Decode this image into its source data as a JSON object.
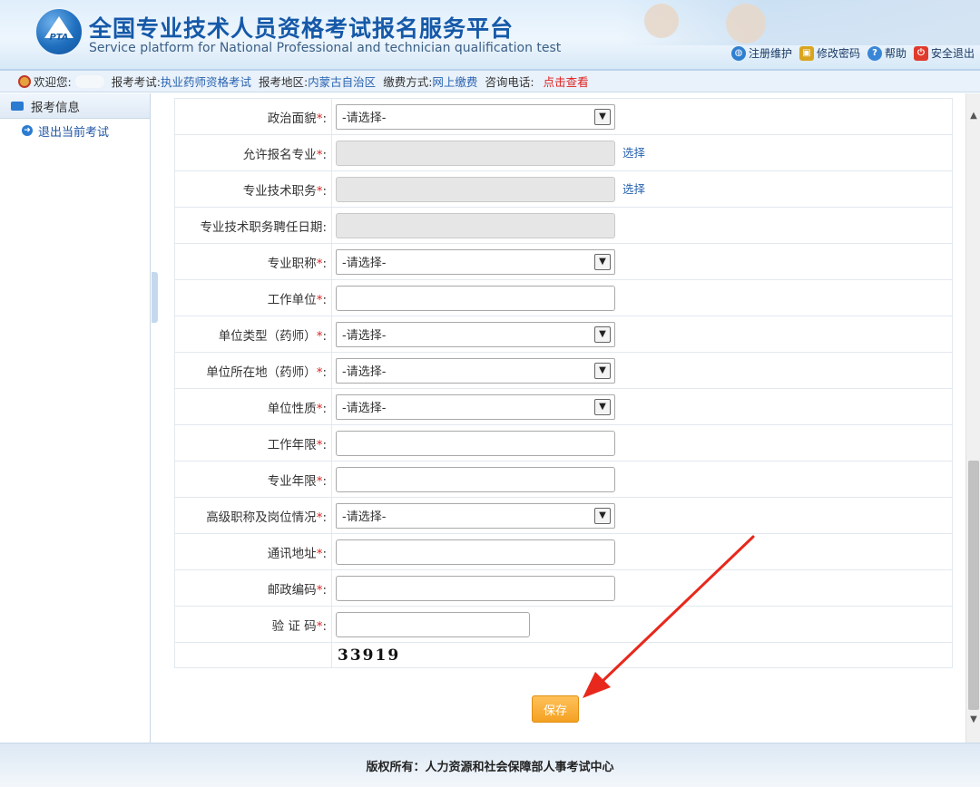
{
  "header": {
    "logo_text": "PTA",
    "title": "全国专业技术人员资格考试报名服务平台",
    "subtitle": "Service platform for National Professional and technician qualification test",
    "links": [
      {
        "label": "注册维护",
        "icon": "globe-icon",
        "color": "#2f7fd0"
      },
      {
        "label": "修改密码",
        "icon": "lock-icon",
        "color": "#d9a520"
      },
      {
        "label": "帮助",
        "icon": "help-icon",
        "color": "#3a86d6"
      },
      {
        "label": "安全退出",
        "icon": "power-icon",
        "color": "#e03a2c"
      }
    ]
  },
  "infobar": {
    "welcome_label": "欢迎您:",
    "exam_label": "报考考试:",
    "exam_value": "执业药师资格考试",
    "region_label": "报考地区:",
    "region_value": "内蒙古自治区",
    "pay_label": "缴费方式:",
    "pay_value": "网上缴费",
    "phone_label": "咨询电话:",
    "phone_value": "点击查看"
  },
  "sidebar": {
    "header": "报考信息",
    "items": [
      {
        "label": "退出当前考试",
        "icon": "arrow-right-circle-icon"
      }
    ]
  },
  "form": {
    "select_placeholder": "-请选择-",
    "choose_label": "选择",
    "fields": [
      {
        "label": "政治面貌",
        "type": "select",
        "required": true
      },
      {
        "label": "允许报名专业",
        "type": "disabled",
        "required": true,
        "choose": true
      },
      {
        "label": "专业技术职务",
        "type": "disabled",
        "required": true,
        "choose": true
      },
      {
        "label": "专业技术职务聘任日期",
        "type": "disabled",
        "required": false
      },
      {
        "label": "专业职称",
        "type": "select",
        "required": true
      },
      {
        "label": "工作单位",
        "type": "text",
        "required": true
      },
      {
        "label": "单位类型（药师）",
        "type": "select",
        "required": true
      },
      {
        "label": "单位所在地（药师）",
        "type": "select",
        "required": true
      },
      {
        "label": "单位性质",
        "type": "select",
        "required": true
      },
      {
        "label": "工作年限",
        "type": "text",
        "required": true
      },
      {
        "label": "专业年限",
        "type": "text",
        "required": true
      },
      {
        "label": "高级职称及岗位情况",
        "type": "select",
        "required": true
      },
      {
        "label": "通讯地址",
        "type": "text",
        "required": true
      },
      {
        "label": "邮政编码",
        "type": "text",
        "required": true
      },
      {
        "label": "验 证 码",
        "type": "captcha",
        "required": true
      }
    ],
    "captcha_text": "33919",
    "save_label": "保存"
  },
  "footer": {
    "copyright": "版权所有：人力资源和社会保障部人事考试中心"
  },
  "colors": {
    "accent_blue": "#2a64b0",
    "required_red": "#e02020",
    "save_orange": "#f4a122",
    "arrow_red": "#e8281c"
  }
}
